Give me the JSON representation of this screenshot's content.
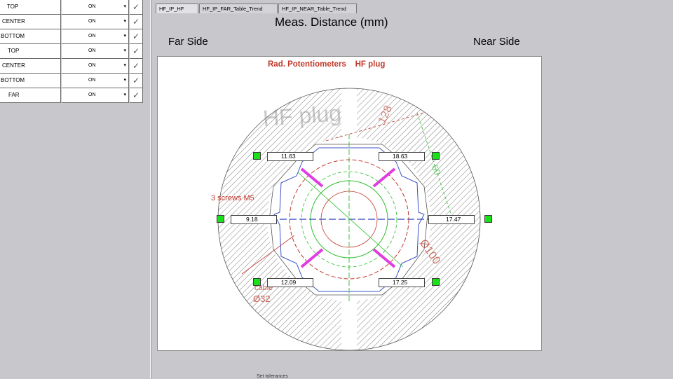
{
  "control_table": {
    "rows": [
      {
        "label": "TOP",
        "state": "ON"
      },
      {
        "label": "CENTER",
        "state": "ON"
      },
      {
        "label": "BOTTOM",
        "state": "ON"
      },
      {
        "label": "TOP",
        "state": "ON"
      },
      {
        "label": "CENTER",
        "state": "ON"
      },
      {
        "label": "BOTTOM",
        "state": "ON"
      },
      {
        "label": "FAR",
        "state": "ON"
      }
    ],
    "check_glyph": "✓",
    "dropdown_glyph": "▾"
  },
  "tabs": [
    {
      "label": "HF_IP_HF"
    },
    {
      "label": "HF_IP_FAR_Table_Trend"
    },
    {
      "label": "HF_IP_NEAR_Table_Trend"
    }
  ],
  "header": {
    "title": "Meas. Distance (mm)",
    "far_side": "Far Side",
    "near_side": "Near Side"
  },
  "diagram": {
    "title": "Rad. Potentiometers    HF plug",
    "title_color": "#c0392b",
    "hf_plug_text": "HF plug",
    "dim_label_1": "3 screws M5",
    "dim_label_2": "cable",
    "dim_label_3": "Ø32",
    "dim_label_4": "Ø100",
    "dim_label_5": "128",
    "dim_label_6": "60",
    "readings": {
      "top_left": "11.63",
      "top_right": "18.63",
      "mid_left": "9.18",
      "mid_right": "17.47",
      "bot_left": "12.09",
      "bot_right": "17.25"
    },
    "led_color": "#19e019"
  },
  "footer": {
    "frame_label": "Set tolerances"
  }
}
